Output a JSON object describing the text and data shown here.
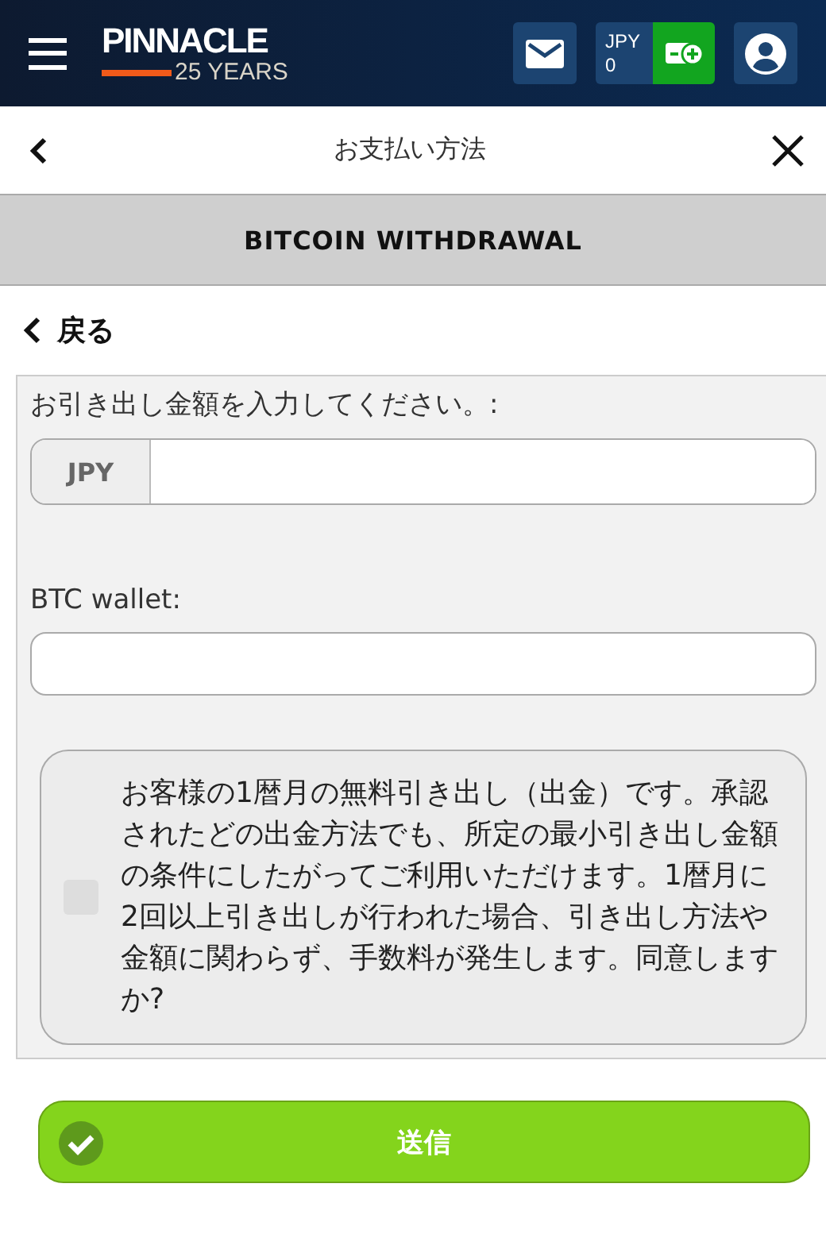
{
  "header": {
    "logo": {
      "name": "PINNACLE",
      "subtitle": "25 YEARS"
    },
    "balance": {
      "currency": "JPY",
      "amount": "0"
    }
  },
  "nav": {
    "title": "お支払い方法"
  },
  "banner": {
    "title": "BITCOIN WITHDRAWAL"
  },
  "back_link": "戻る",
  "form": {
    "amount_label": "お引き出し金額を入力してください。:",
    "currency_prefix": "JPY",
    "wallet_label": "BTC wallet:",
    "agreement": {
      "checked": false,
      "text": "お客様の1暦月の無料引き出し（出金）です。承認されたどの出金方法でも、所定の最小引き出し金額の条件にしたがってご利用いただけます。1暦月に2回以上引き出しが行われた場合、引き出し方法や金額に関わらず、手数料が発生します。同意しますか?"
    }
  },
  "submit": {
    "label": "送信"
  }
}
